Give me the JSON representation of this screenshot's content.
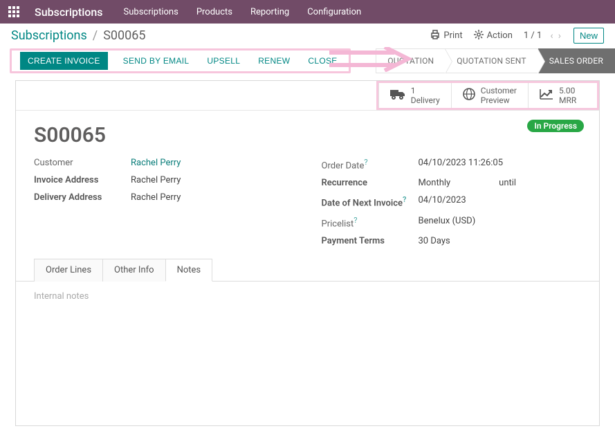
{
  "topbar": {
    "brand": "Subscriptions",
    "menu": {
      "subscriptions": "Subscriptions",
      "products": "Products",
      "reporting": "Reporting",
      "configuration": "Configuration"
    }
  },
  "breadcrumb": {
    "root": "Subscriptions",
    "sep": "/",
    "current": "S00065"
  },
  "toolbar": {
    "print": "Print",
    "action": "Action",
    "pager": "1 / 1",
    "new": "New"
  },
  "actions": {
    "create_invoice": "CREATE INVOICE",
    "send_by_email": "SEND BY EMAIL",
    "upsell": "UPSELL",
    "renew": "RENEW",
    "close": "CLOSE"
  },
  "stages": {
    "quotation": "QUOTATION",
    "quotation_sent": "QUOTATION SENT",
    "sales_order": "SALES ORDER"
  },
  "stats": {
    "delivery": {
      "count": "1",
      "label": "Delivery"
    },
    "preview": {
      "label1": "Customer",
      "label2": "Preview"
    },
    "mrr": {
      "amount": "5.00",
      "label": "MRR"
    }
  },
  "status_badge": "In Progress",
  "record": {
    "name": "S00065",
    "left": {
      "customer_label": "Customer",
      "customer_value": "Rachel Perry",
      "invoice_addr_label": "Invoice Address",
      "invoice_addr_value": "Rachel Perry",
      "delivery_addr_label": "Delivery Address",
      "delivery_addr_value": "Rachel Perry"
    },
    "right": {
      "order_date_label": "Order Date",
      "order_date_value": "04/10/2023 11:26:05",
      "recurrence_label": "Recurrence",
      "recurrence_value": "Monthly",
      "recurrence_until": "until",
      "next_invoice_label": "Date of Next Invoice",
      "next_invoice_value": "04/10/2023",
      "pricelist_label": "Pricelist",
      "pricelist_value": "Benelux (USD)",
      "payment_terms_label": "Payment Terms",
      "payment_terms_value": "30 Days"
    }
  },
  "tabs": {
    "order_lines": "Order Lines",
    "other_info": "Other Info",
    "notes": "Notes"
  },
  "notes_placeholder": "Internal notes"
}
